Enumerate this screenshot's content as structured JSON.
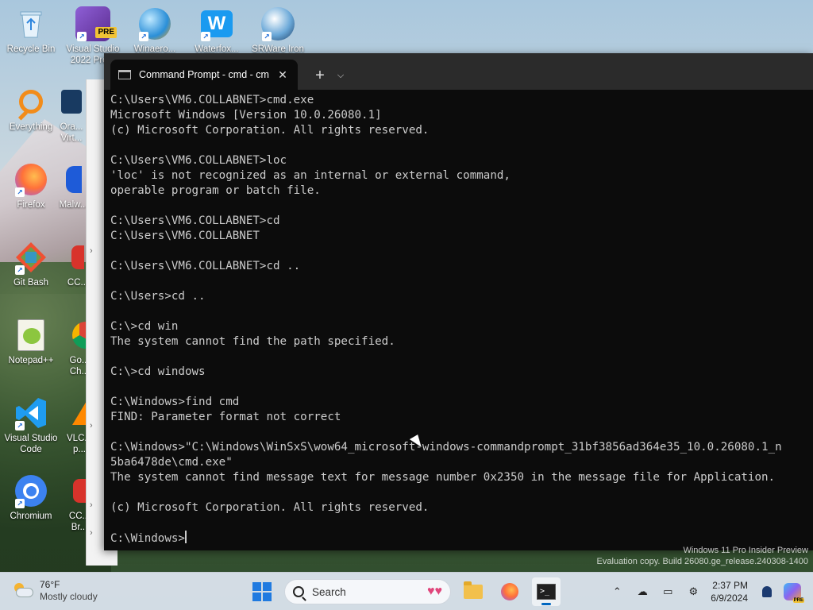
{
  "desktop": {
    "icons": [
      {
        "label": "Recycle Bin",
        "icon": "recycle-bin-icon"
      },
      {
        "label": "Visual Studio 2022 Pre...",
        "icon": "visual-studio-icon",
        "badge": "PRE"
      },
      {
        "label": "Winaero...",
        "icon": "winaero-icon"
      },
      {
        "label": "Waterfox...",
        "icon": "waterfox-icon"
      },
      {
        "label": "SRWare Iron",
        "icon": "srware-iron-icon"
      },
      {
        "label": "Everything",
        "icon": "everything-icon"
      },
      {
        "label": "Ora... Virt...",
        "icon": "virtualbox-icon"
      },
      {
        "label": "Firefox",
        "icon": "firefox-icon"
      },
      {
        "label": "Malw...",
        "icon": "malwarebytes-icon"
      },
      {
        "label": "Git Bash",
        "icon": "git-bash-icon"
      },
      {
        "label": "CC...",
        "icon": "ccleaner-icon"
      },
      {
        "label": "Notepad++",
        "icon": "notepadpp-icon"
      },
      {
        "label": "Go... Ch...",
        "icon": "chrome-icon"
      },
      {
        "label": "Visual Studio Code",
        "icon": "vscode-icon"
      },
      {
        "label": "VLC... p...",
        "icon": "vlc-icon"
      },
      {
        "label": "Chromium",
        "icon": "chromium-icon"
      },
      {
        "label": "CC... Br...",
        "icon": "ccleaner-browser-icon"
      }
    ]
  },
  "terminal": {
    "tab_title": "Command Prompt - cmd - cm",
    "close_glyph": "✕",
    "new_tab_glyph": "+",
    "dropdown_glyph": "⌵",
    "lines": [
      "C:\\Users\\VM6.COLLABNET>cmd.exe",
      "Microsoft Windows [Version 10.0.26080.1]",
      "(c) Microsoft Corporation. All rights reserved.",
      "",
      "C:\\Users\\VM6.COLLABNET>loc",
      "'loc' is not recognized as an internal or external command,",
      "operable program or batch file.",
      "",
      "C:\\Users\\VM6.COLLABNET>cd",
      "C:\\Users\\VM6.COLLABNET",
      "",
      "C:\\Users\\VM6.COLLABNET>cd ..",
      "",
      "C:\\Users>cd ..",
      "",
      "C:\\>cd win",
      "The system cannot find the path specified.",
      "",
      "C:\\>cd windows",
      "",
      "C:\\Windows>find cmd",
      "FIND: Parameter format not correct",
      "",
      "C:\\Windows>\"C:\\Windows\\WinSxS\\wow64_microsoft-windows-commandprompt_31bf3856ad364e35_10.0.26080.1_n",
      "5ba6478de\\cmd.exe\"",
      "The system cannot find message text for message number 0x2350 in the message file for Application.",
      "",
      "(c) Microsoft Corporation. All rights reserved.",
      ""
    ],
    "prompt": "C:\\Windows>"
  },
  "watermark": {
    "line1": "Windows 11 Pro Insider Preview",
    "line2": "Evaluation copy. Build 26080.ge_release.240308-1400"
  },
  "taskbar": {
    "weather": {
      "temp": "76°F",
      "condition": "Mostly cloudy"
    },
    "search_placeholder": "Search",
    "time": "2:37 PM",
    "date": "6/9/2024",
    "copilot_badge": "PRE",
    "accent": "#0067c0"
  }
}
